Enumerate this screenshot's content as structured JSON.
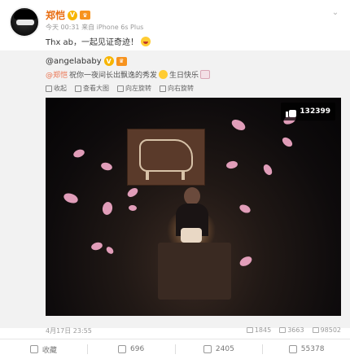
{
  "post": {
    "username": "郑恺",
    "v_badge": "V",
    "meta": "今天 00:31 来自 iPhone 6s Plus",
    "text": "Thx ab，一起见证奇迹！"
  },
  "repost": {
    "user": "@angelababy",
    "v_badge": "V",
    "mention": "@郑恺",
    "text_1": "祝你一夜间长出飘逸的秀发",
    "text_2": "生日快乐",
    "toolbar": {
      "collect": "收起",
      "view_large": "查看大图",
      "rotate_left": "向左旋转",
      "rotate_right": "向右旋转"
    },
    "photo_likes": "132399",
    "date": "4月17日 23:55",
    "reposts": "1845",
    "comments": "3663",
    "likes": "98502"
  },
  "actions": {
    "collect": "收藏",
    "repost": "696",
    "comment": "2405",
    "like": "55378"
  },
  "icons": {
    "chevron": "chevron-down-icon",
    "thumb": "thumbs-up-icon"
  },
  "colors": {
    "username": "#e86b0e",
    "mention": "#eb7350",
    "repost_bg": "#f2f2f2",
    "petal": "#f2a9c8"
  }
}
